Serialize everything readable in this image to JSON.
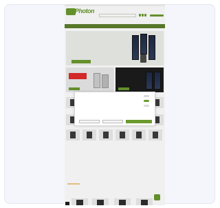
{
  "site": {
    "logo_text": "Photon",
    "top_strip": "",
    "top_links": "",
    "search_placeholder": "",
    "nav_items": ""
  },
  "hero": {
    "title": "",
    "subtitle": "",
    "cta": ""
  },
  "promos": [
    {
      "badge": "",
      "text": "",
      "cta": ""
    },
    {
      "badge": "",
      "text": "",
      "cta": ""
    }
  ],
  "cookie_modal": {
    "options": [
      "",
      "",
      ""
    ],
    "option_states": [
      false,
      true,
      false
    ],
    "notice": "",
    "buttons": [
      "",
      "",
      ""
    ],
    "footer": ""
  },
  "brands": [
    "",
    "",
    "",
    "",
    "",
    "",
    "",
    "",
    "",
    "",
    "",
    "",
    "",
    "",
    ""
  ],
  "brand_colors": [
    "#d0252b",
    "#2b8fd6",
    "#2a67b0",
    "#c9a93a",
    "#555555",
    "#c21e2a",
    "#1a5fa8",
    "#2b4c8e",
    "#4c9a2a",
    "#d0252b",
    "#d0252b",
    "#1a3f8c",
    "#c21e2a",
    "#c21e2a",
    "#c21e2a"
  ],
  "colors": {
    "accent": "#6a9a2e",
    "nav": "#5d7f2c",
    "promo_badge": "#e02b2b"
  }
}
